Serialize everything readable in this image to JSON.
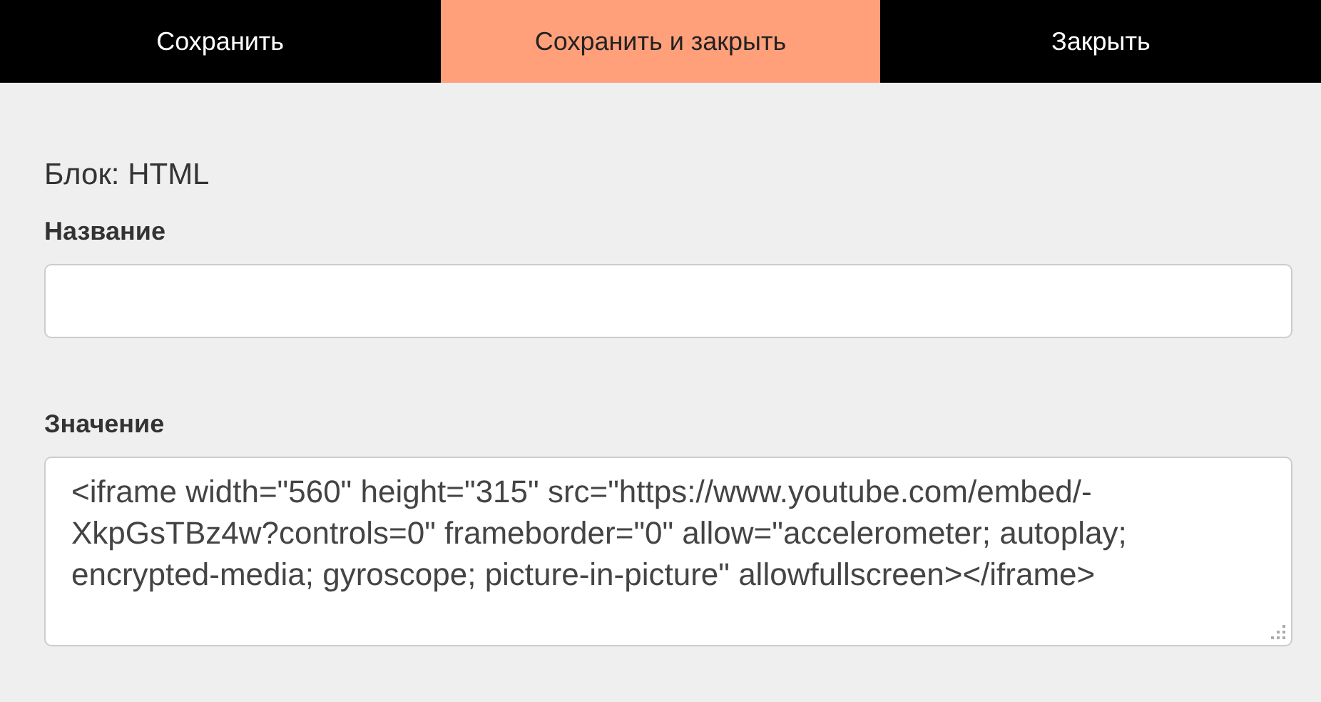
{
  "toolbar": {
    "buttons": [
      {
        "label": "Сохранить",
        "selected": false
      },
      {
        "label": "Сохранить и закрыть",
        "selected": true
      },
      {
        "label": "Закрыть",
        "selected": false
      }
    ]
  },
  "heading": "Блок: HTML",
  "fields": [
    {
      "label": "Название",
      "kind": "input"
    },
    {
      "label": "Значение",
      "kind": "textarea",
      "value": "<iframe width=\"560\" height=\"315\" src=\"https://www.youtube.com/embed/-XkpGsTBz4w?controls=0\" frameborder=\"0\" allow=\"accelerometer; autoplay; encrypted-media; gyroscope; picture-in-picture\" allowfullscreen></iframe>"
    }
  ]
}
